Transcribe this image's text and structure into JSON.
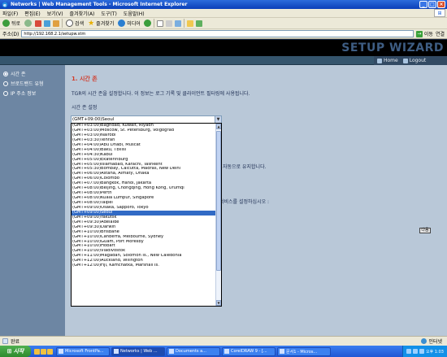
{
  "window": {
    "title": "Networks | Web Management Tools - Microsoft Internet Explorer",
    "min": "_",
    "max": "□",
    "close": "×"
  },
  "menu": [
    "파일(F)",
    "편집(E)",
    "보기(V)",
    "즐겨찾기(A)",
    "도구(T)",
    "도움말(H)"
  ],
  "toolbar": {
    "back": "뒤로",
    "search": "검색",
    "favorites": "즐겨찾기",
    "media": "미디어"
  },
  "address": {
    "label": "주소(D)",
    "url": "http://192.168.2.1/setupw.stm",
    "go": "이동",
    "links": "연결"
  },
  "banner": {
    "title": "SETUP WIZARD",
    "home": "Home",
    "logout": "Logout"
  },
  "sidebar": {
    "items": [
      {
        "label": "시간 존",
        "selected": true
      },
      {
        "label": "브로드밴드 유형",
        "selected": false
      },
      {
        "label": "IP 주소 정보",
        "selected": false
      }
    ]
  },
  "main": {
    "title": "1. 시간 존",
    "description": "TGR의 시간 존을 설정합니다. 이 정보는 로그 기록 및 클라이언트 필터링에 사용됩니다.",
    "subheading": "시간 존 설정",
    "partial_line1": "자동으로 유지합니다.",
    "partial_line2": "서비스를 설정하십시오 :",
    "apply": "다음"
  },
  "timezone": {
    "current": "(GMT+09:00)Seoul",
    "options": [
      "(GMT+03:00)Baghdad, Kuwait, Riyadh",
      "(GMT+03:00)Moscow, St. Petersburg, Volgograd",
      "(GMT+03:00)Nairobi",
      "(GMT+03:30)Tehran",
      "(GMT+04:00)Abu Dhabi, Muscat",
      "(GMT+04:00)Baku, Tbilisi",
      "(GMT+04:30)Kabul",
      "(GMT+05:00)Ekaterinburg",
      "(GMT+05:00)Islamabad, Karachi, Tashkent",
      "(GMT+05:30)Bombay, Calcutta, Madras, New Delhi",
      "(GMT+06:00)Astana, Almaty, Dhaka",
      "(GMT+06:00)Colombo",
      "(GMT+07:00)Bangkok, Hanoi, Jakarta",
      "(GMT+08:00)Beijing, Chongqing, Hong Kong, Urumqi",
      "(GMT+08:00)Perth",
      "(GMT+08:00)Kuala Lumpur, Singapore",
      "(GMT+08:00)Taipei",
      "(GMT+09:00)Osaka, Sapporo, Tokyo",
      "(GMT+09:00)Seoul",
      "(GMT+09:00)Yakutsk",
      "(GMT+09:30)Adelaide",
      "(GMT+09:30)Darwin",
      "(GMT+10:00)Brisbane",
      "(GMT+10:00)Canberra, Melbourne, Sydney",
      "(GMT+10:00)Guam, Port Moresby",
      "(GMT+10:00)Hobart",
      "(GMT+10:00)Vladivostok",
      "(GMT+11:00)Magadan, Solomon Is., New Caledonia",
      "(GMT+12:00)Auckland, Wllington",
      "(GMT+12:00)Fiji, Kamchatka, Marshall Is."
    ],
    "selected_index": 18
  },
  "statusbar": {
    "left": "완료",
    "zone": "인터넷"
  },
  "taskbar": {
    "start": "시작",
    "tasks": [
      "Microsoft FrontPa...",
      "Networks | Web ...",
      "Documents a...",
      "CorelDRAW 9 - [...",
      "문서1 - Micros..."
    ],
    "active_task": 1,
    "clock": "오후 1:03"
  },
  "colors": {
    "accent": "#d23c2a",
    "page_bg": "#b9c8d8",
    "sidebar": "#6d86a3",
    "selection": "#316ac5"
  }
}
